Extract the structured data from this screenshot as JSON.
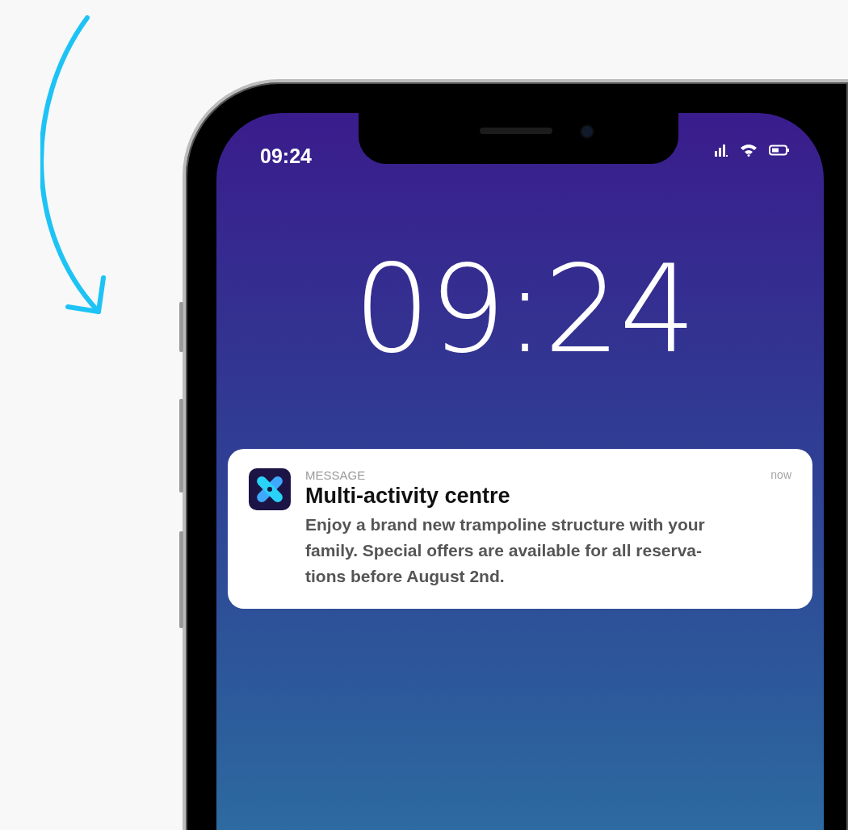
{
  "status_bar": {
    "time": "09:24"
  },
  "lock_screen": {
    "clock": "09:24"
  },
  "notification": {
    "app_label": "MESSAGE",
    "time": "now",
    "title": "Multi-activity centre",
    "body_lines": [
      "Enjoy a brand new trampoline structure with your",
      "family. Special offers are available for all reserva-",
      "tions before August 2nd."
    ]
  }
}
